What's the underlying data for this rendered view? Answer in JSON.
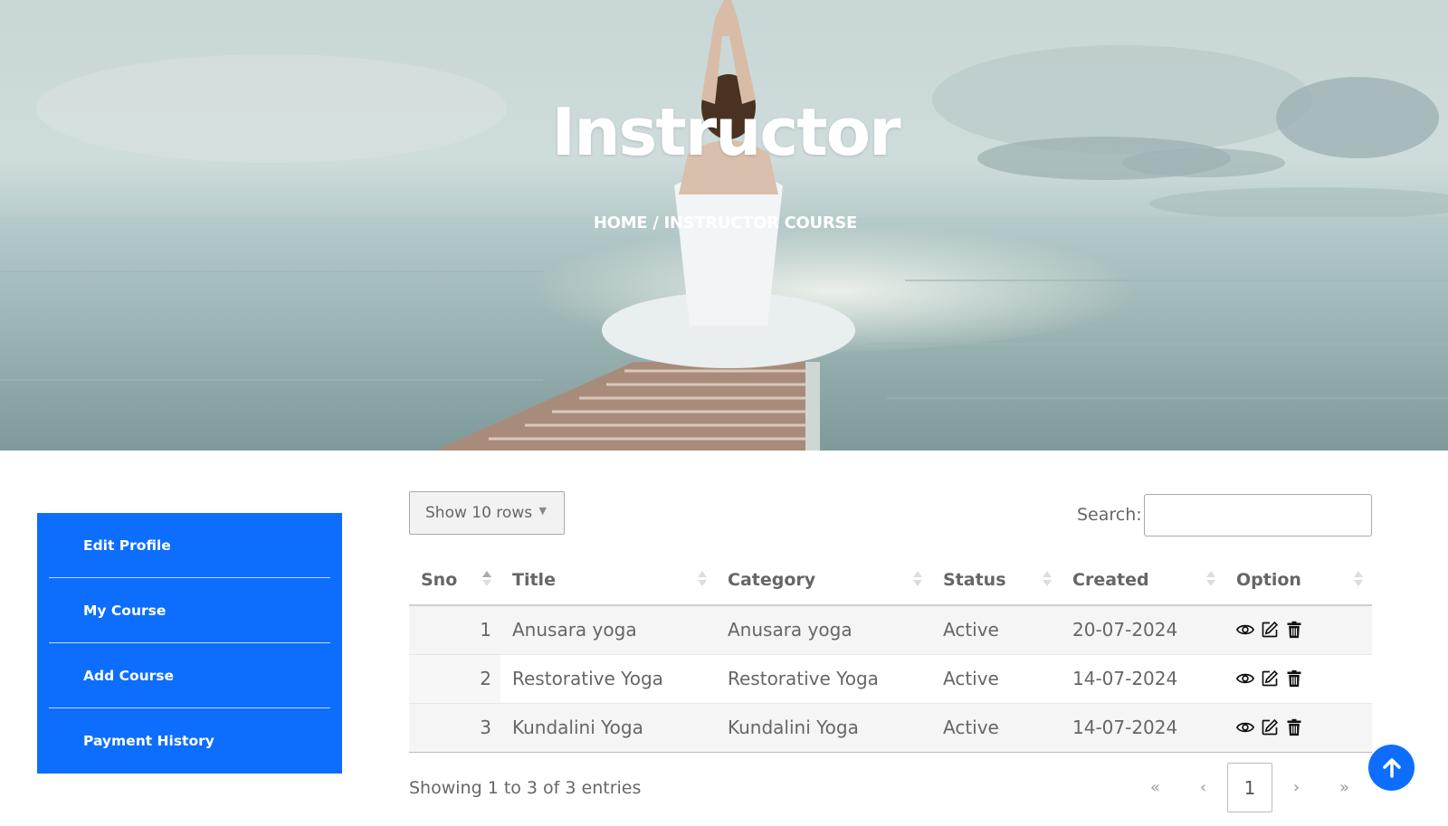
{
  "hero": {
    "title": "Instructor",
    "breadcrumb": "HOME / INSTRUCTOR COURSE"
  },
  "sidebar": {
    "items": [
      {
        "label": "Edit Profile"
      },
      {
        "label": "My Course"
      },
      {
        "label": "Add Course"
      },
      {
        "label": "Payment History"
      }
    ]
  },
  "table_controls": {
    "show_rows": "Show 10 rows",
    "search_label": "Search:",
    "search_value": ""
  },
  "table": {
    "columns": [
      "Sno",
      "Title",
      "Category",
      "Status",
      "Created",
      "Option"
    ],
    "rows": [
      {
        "sno": "1",
        "title": "Anusara yoga",
        "category": "Anusara yoga",
        "status": "Active",
        "created": "20-07-2024"
      },
      {
        "sno": "2",
        "title": "Restorative Yoga",
        "category": "Restorative Yoga",
        "status": "Active",
        "created": "14-07-2024"
      },
      {
        "sno": "3",
        "title": "Kundalini Yoga",
        "category": "Kundalini Yoga",
        "status": "Active",
        "created": "14-07-2024"
      }
    ]
  },
  "footer": {
    "info": "Showing 1 to 3 of 3 entries",
    "pager": {
      "first": "«",
      "prev": "‹",
      "current": "1",
      "next": "›",
      "last": "»"
    }
  },
  "colors": {
    "accent": "#0d6efd"
  },
  "icons": {
    "view": "eye-icon",
    "edit": "edit-icon",
    "delete": "trash-icon",
    "scroll_top": "arrow-up-icon"
  }
}
